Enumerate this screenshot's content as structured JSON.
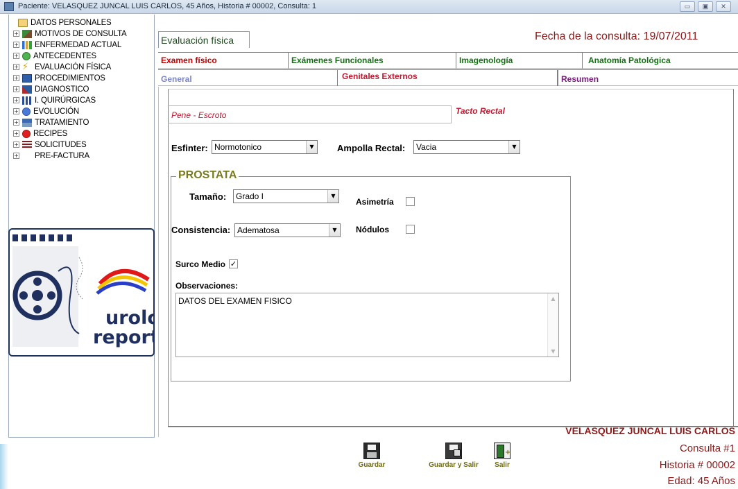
{
  "window": {
    "title": "Paciente: VELASQUEZ JUNCAL LUIS CARLOS, 45 Años, Historia # 00002, Consulta: 1",
    "minimize": "▭",
    "maximize": "▣",
    "close": "✕"
  },
  "tree": {
    "items": [
      {
        "label": "DATOS PERSONALES",
        "icon": "folder-icon",
        "expander": ""
      },
      {
        "label": "MOTIVOS DE CONSULTA",
        "icon": "consult-icon",
        "expander": "+"
      },
      {
        "label": "ENFERMEDAD ACTUAL",
        "icon": "chart-icon",
        "expander": "+"
      },
      {
        "label": "ANTECEDENTES",
        "icon": "globe-icon",
        "expander": "+"
      },
      {
        "label": "EVALUACIÓN FÍSICA",
        "icon": "lightning-icon",
        "expander": "+"
      },
      {
        "label": "PROCEDIMIENTOS",
        "icon": "procedures-icon",
        "expander": "+"
      },
      {
        "label": "DIAGNOSTICO",
        "icon": "diagnosis-icon",
        "expander": "+"
      },
      {
        "label": "I. QUIRÚRGICAS",
        "icon": "grid-icon",
        "expander": "+"
      },
      {
        "label": "EVOLUCIÓN",
        "icon": "info-icon",
        "expander": "+"
      },
      {
        "label": "TRATAMIENTO",
        "icon": "treatment-icon",
        "expander": "+"
      },
      {
        "label": "RECIPES",
        "icon": "apple-icon",
        "expander": "+"
      },
      {
        "label": "SOLICITUDES",
        "icon": "list-icon",
        "expander": "+"
      },
      {
        "label": "PRE-FACTURA",
        "icon": "",
        "expander": "+"
      }
    ]
  },
  "logo": {
    "text_line1": "urolo",
    "text_line2": "report"
  },
  "header": {
    "section_tab": "Evaluación física",
    "fecha": "Fecha de la consulta:  19/07/2011"
  },
  "tabs_main": [
    {
      "label": "Examen físico",
      "color": "#c00000"
    },
    {
      "label": "Exámenes Funcionales",
      "color": "#127012"
    },
    {
      "label": "Imagenología",
      "color": "#127012"
    },
    {
      "label": "Anatomía Patológica",
      "color": "#127012"
    }
  ],
  "tabs_sub": [
    {
      "label": "General",
      "color": "#7b86c9"
    },
    {
      "label": "Genitales Externos",
      "color": "#c0182f"
    },
    {
      "label": "Resumen",
      "color": "#7a1a7a"
    }
  ],
  "tabs_inner": [
    {
      "label": "Pene - Escroto",
      "color": "#c0182f"
    },
    {
      "label": "Tacto Rectal",
      "color": "#c0182f"
    }
  ],
  "form": {
    "esfinter_label": "Esfinter:",
    "esfinter_value": "Normotonico",
    "ampolla_label": "Ampolla Rectal:",
    "ampolla_value": "Vacia",
    "prostata_title": "PROSTATA",
    "tamano_label": "Tamaño:",
    "tamano_value": "Grado I",
    "asimetria_label": "Asimetría",
    "asimetria_checked": false,
    "consistencia_label": "Consistencia:",
    "consistencia_value": "Adematosa",
    "nodulos_label": "Nódulos",
    "nodulos_checked": false,
    "surco_label": "Surco Medio",
    "surco_mark": "✓",
    "observaciones_label": "Observaciones:",
    "observaciones_value": "DATOS DEL EXAMEN FISICO"
  },
  "footer": {
    "patient_name": "VELASQUEZ JUNCAL LUIS CARLOS",
    "consulta": "Consulta #1",
    "historia": "Historia # 00002",
    "edad": "Edad: 45 Años",
    "buttons": [
      {
        "label": "Guardar",
        "icon": "save-icon"
      },
      {
        "label": "Guardar y Salir",
        "icon": "save-exit-icon"
      },
      {
        "label": "Salir",
        "icon": "exit-door-icon"
      }
    ]
  },
  "colors": {
    "accent_dark_red": "#8b1a1a",
    "olive_buttons": "#6e6a14",
    "prostata_title": "#7c7a1e"
  }
}
